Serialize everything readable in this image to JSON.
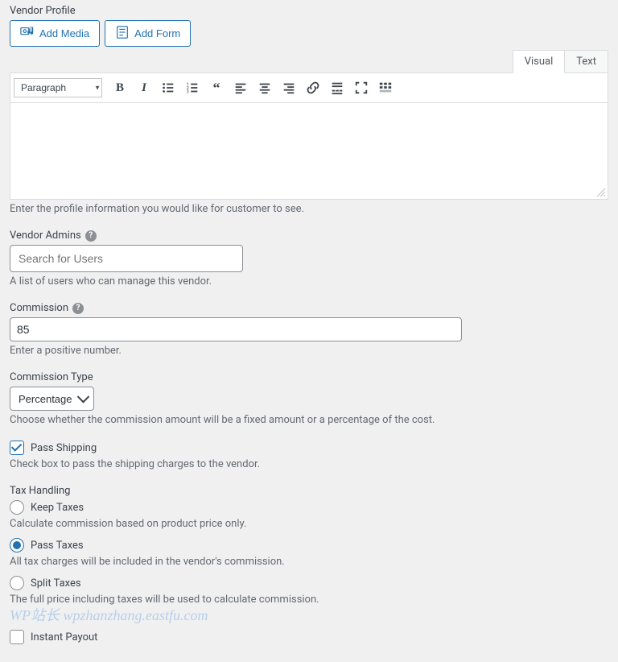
{
  "vendorProfile": {
    "label": "Vendor Profile",
    "addMedia": "Add Media",
    "addForm": "Add Form",
    "tabs": {
      "visual": "Visual",
      "text": "Text"
    },
    "formatSelect": "Paragraph",
    "help": "Enter the profile information you would like for customer to see."
  },
  "vendorAdmins": {
    "label": "Vendor Admins",
    "placeholder": "Search for Users",
    "help": "A list of users who can manage this vendor."
  },
  "commission": {
    "label": "Commission",
    "value": "85",
    "help": "Enter a positive number."
  },
  "commissionType": {
    "label": "Commission Type",
    "value": "Percentage",
    "help": "Choose whether the commission amount will be a fixed amount or a percentage of the cost."
  },
  "passShipping": {
    "label": "Pass Shipping",
    "help": "Check box to pass the shipping charges to the vendor."
  },
  "taxHandling": {
    "label": "Tax Handling",
    "options": {
      "keep": {
        "label": "Keep Taxes",
        "help": "Calculate commission based on product price only."
      },
      "pass": {
        "label": "Pass Taxes",
        "help": "All tax charges will be included in the vendor's commission."
      },
      "split": {
        "label": "Split Taxes",
        "help": "The full price including taxes will be used to calculate commission."
      }
    }
  },
  "instantPayout": {
    "label": "Instant Payout"
  },
  "watermark": "WP站长  wpzhanzhang.eastfu.com"
}
